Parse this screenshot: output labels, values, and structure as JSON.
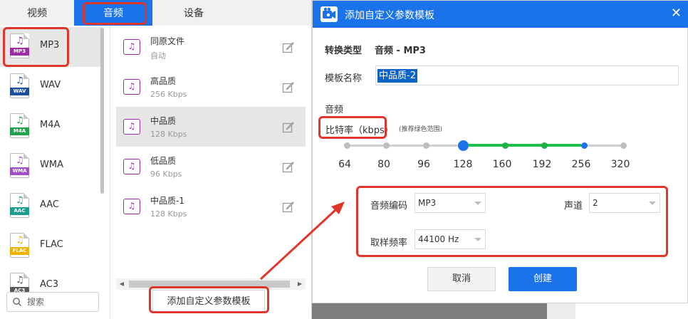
{
  "tabs": [
    {
      "label": "视频"
    },
    {
      "label": "音频"
    },
    {
      "label": "设备"
    }
  ],
  "formats": [
    {
      "label": "MP3",
      "tag": "MP3",
      "color": "#9b2ea5"
    },
    {
      "label": "WAV",
      "tag": "WAV",
      "color": "#1f4e9c"
    },
    {
      "label": "M4A",
      "tag": "M4A",
      "color": "#21a14c"
    },
    {
      "label": "WMA",
      "tag": "WMA",
      "color": "#a14fc7"
    },
    {
      "label": "AAC",
      "tag": "AAC",
      "color": "#1c9d8e"
    },
    {
      "label": "FLAC",
      "tag": "FLAC",
      "color": "#f0b400"
    },
    {
      "label": "AC3",
      "tag": "AC3",
      "color": "#5a5a5a"
    }
  ],
  "presets": [
    {
      "name": "同原文件",
      "desc": "自动"
    },
    {
      "name": "高品质",
      "desc": "256 Kbps"
    },
    {
      "name": "中品质",
      "desc": "128 Kbps"
    },
    {
      "name": "低品质",
      "desc": "96 Kbps"
    },
    {
      "name": "中品质-1",
      "desc": "128 Kbps"
    }
  ],
  "search": {
    "placeholder": "搜索"
  },
  "add_template_label": "添加自定义参数模板",
  "dialog": {
    "title": "添加自定义参数模板",
    "convert_type_label": "转换类型",
    "convert_type_value": "音频 - MP3",
    "template_name_label": "模板名称",
    "template_name_value": "中品质-2",
    "audio_section": "音频",
    "bitrate_label": "比特率（kbps）",
    "bitrate_hint": "(推荐绿色范围)",
    "bitrate_ticks": [
      "64",
      "80",
      "96",
      "128",
      "160",
      "192",
      "256",
      "320"
    ],
    "bitrate_value": "128",
    "codec_label": "音频编码",
    "codec_value": "MP3",
    "channel_label": "声道",
    "channel_value": "2",
    "samplerate_label": "取样频率",
    "samplerate_value": "44100 Hz",
    "cancel_label": "取消",
    "create_label": "创建"
  },
  "colors": {
    "accent": "#1a73e8",
    "recommended": "#22c04a",
    "annotation": "#e0352a"
  }
}
